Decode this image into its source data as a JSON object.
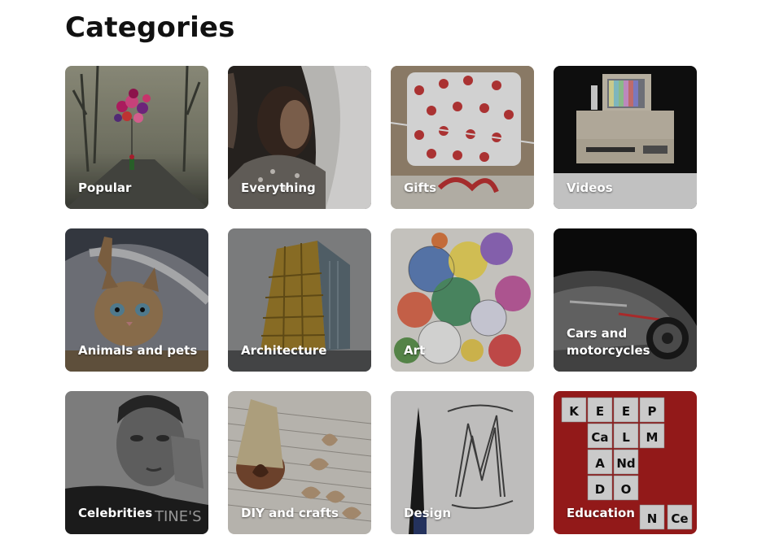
{
  "page": {
    "title": "Categories"
  },
  "categories": [
    {
      "label": "Popular",
      "image": "balloons-on-road-image"
    },
    {
      "label": "Everything",
      "image": "woman-with-veil-image"
    },
    {
      "label": "Gifts",
      "image": "wrapped-gift-image"
    },
    {
      "label": "Videos",
      "image": "retro-tv-vcr-image"
    },
    {
      "label": "Animals and pets",
      "image": "kitten-under-veil-image"
    },
    {
      "label": "Architecture",
      "image": "glass-building-image"
    },
    {
      "label": "Art",
      "image": "paint-circles-image"
    },
    {
      "label": "Cars and motorcycles",
      "image": "supercar-image"
    },
    {
      "label": "Celebrities",
      "image": "man-portrait-image"
    },
    {
      "label": "DIY and crafts",
      "image": "wooden-hearts-cork-image"
    },
    {
      "label": "Design",
      "image": "pen-letter-sketch-image"
    },
    {
      "label": "Education",
      "image": "keep-calm-periodic-table-image",
      "image_text": [
        "K",
        "E",
        "E",
        "P",
        "Ca",
        "L",
        "M",
        "A",
        "Nd",
        "D",
        "O",
        "N",
        "Ce"
      ]
    }
  ]
}
